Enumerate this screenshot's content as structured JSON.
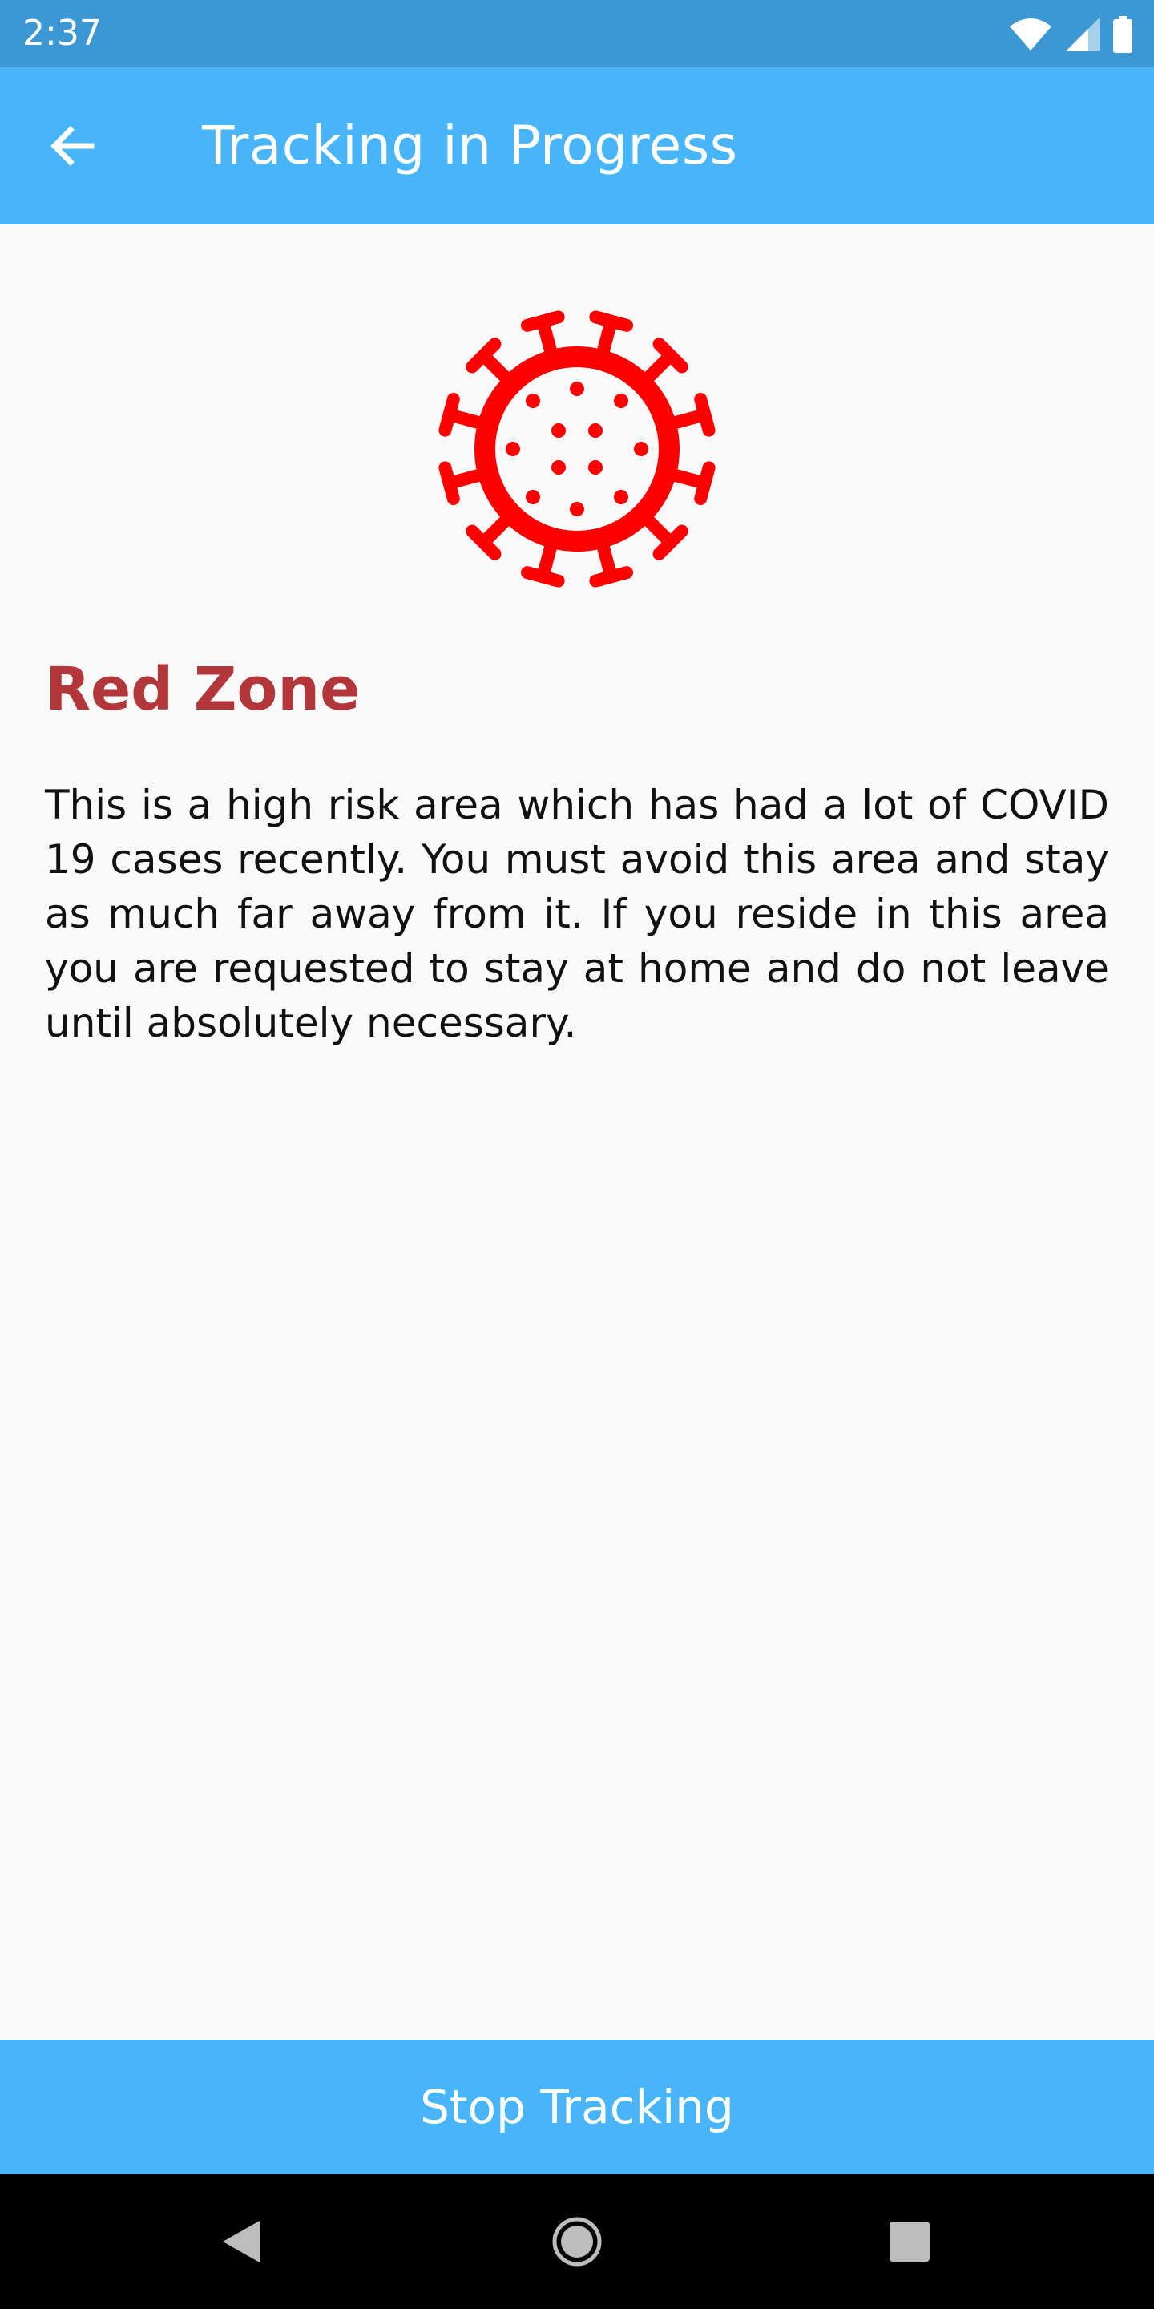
{
  "status_bar": {
    "time": "2:37",
    "icons": [
      "wifi-icon",
      "cell-signal-icon",
      "battery-icon"
    ]
  },
  "app_bar": {
    "title": "Tracking in Progress",
    "back_icon": "arrow-left-icon"
  },
  "content": {
    "icon": "virus-icon",
    "zone_title": "Red Zone",
    "description": "This is a high risk area which has had a lot of COVID 19 cases recently. You must avoid this area and stay as much far away from it. If you reside in this area you are requested to stay at home and do not leave until absolutely necessary."
  },
  "actions": {
    "stop_label": "Stop Tracking"
  },
  "nav_bar": {
    "icons": [
      "back-triangle-icon",
      "home-circle-icon",
      "recents-square-icon"
    ]
  },
  "colors": {
    "status_bar": "#3c97d3",
    "app_bar": "#47b5f7",
    "virus": "#ff0000",
    "zone_title": "#b3363b"
  }
}
